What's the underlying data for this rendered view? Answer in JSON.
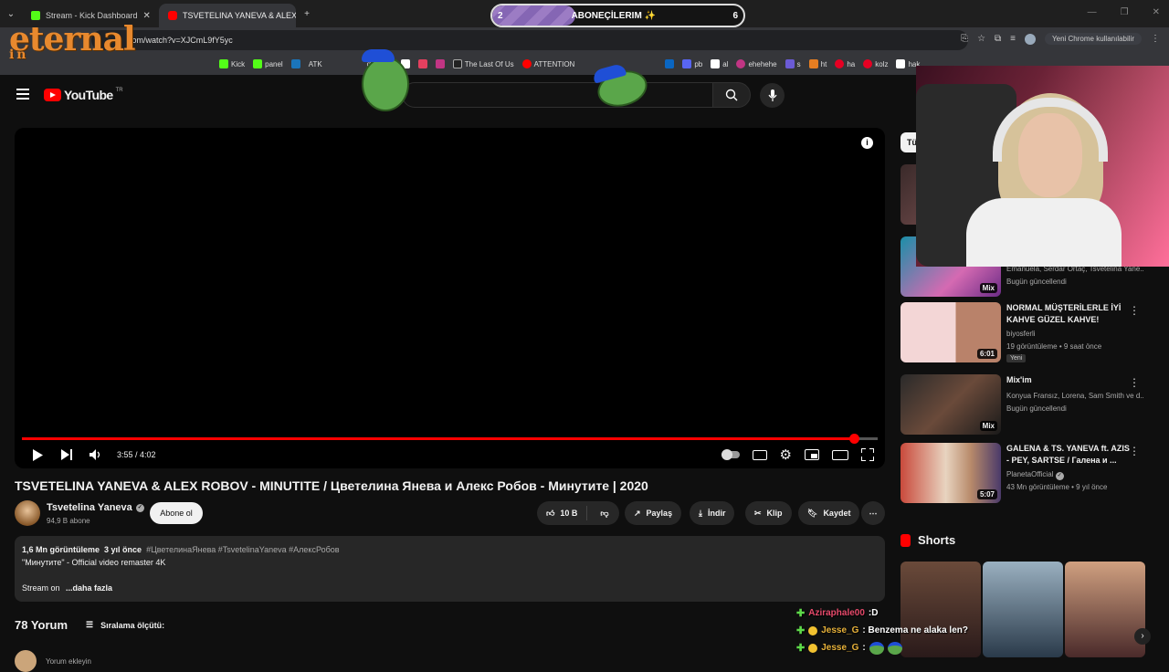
{
  "browser": {
    "tabs": [
      {
        "label": "Stream - Kick Dashboard",
        "color": "#53fc18"
      },
      {
        "label": "TSVETELINA YANEVA & ALEX R",
        "color": "#ff0000"
      }
    ],
    "url": "com/watch?v=XJCmL9fY5yc",
    "update_label": "Yeni Chrome kullanılabilir",
    "bookmarks": [
      "Kick",
      "panel",
      "ATK",
      "d+",
      "The Last Of Us",
      "ATTENTION",
      "pb",
      "ehehehe",
      "s",
      "ht",
      "ha",
      "kolz",
      "hak"
    ]
  },
  "overlay": {
    "logo_text": "eternal",
    "logo_sub": "i n",
    "sub_goal": {
      "current": "2",
      "label": "ABONEÇİLERIM ✨",
      "target": "6",
      "progress": 0.33
    }
  },
  "youtube": {
    "logo": "YouTube",
    "region": "TR",
    "player": {
      "time": "3:55 / 4:02",
      "progress": 0.972
    },
    "video_title": "TSVETELINA YANEVA & ALEX ROBOV - MINUTITE / Цветелина Янева и Алекс Робов - Минутите | 2020",
    "channel": {
      "name": "Tsvetelina Yaneva",
      "subs": "94,9 B abone"
    },
    "subscribe": "Abone ol",
    "actions": {
      "likes": "10 B",
      "share": "Paylaş",
      "download": "İndir",
      "clip": "Klip",
      "save": "Kaydet"
    },
    "description": {
      "views": "1,6 Mn görüntüleme",
      "age": "3 yıl önce",
      "tags": "#ЦветелинаЯнева #TsvetelinaYaneva #АлексРобов",
      "line1": "\"Минутите\" - Official video remaster 4K",
      "line2_prefix": "Stream on",
      "more": "...daha fazla"
    },
    "comments": {
      "count": "78 Yorum",
      "sort": "Sıralama ölçütü:",
      "add": "Yorum ekleyin"
    },
    "chip_all": "Tü",
    "recommendations": [
      {
        "title": "",
        "channel": "Emanuela, Serdar Ortaç, Tsvetelina Yane...",
        "meta": "Bugün güncellendi",
        "duration": "Mix",
        "badge": ""
      },
      {
        "title": "NORMAL MÜŞTERİLERLE İYİ KAHVE GÜZEL KAHVE!",
        "channel": "biyosferli",
        "meta": "19 görüntüleme • 9 saat önce",
        "duration": "6:01",
        "badge": "Yeni"
      },
      {
        "title": "Mix'im",
        "channel": "Konyua Fransız, Lorena, Sam Smith ve d...",
        "meta": "Bugün güncellendi",
        "duration": "Mix",
        "badge": ""
      },
      {
        "title": "GALENA & TS. YANEVA ft. AZIS - PEY, SARTSE / Галена и ...",
        "channel": "PlanetaOfficial",
        "meta": "43 Mn görüntüleme • 9 yıl önce",
        "duration": "5:07",
        "badge": ""
      }
    ],
    "shorts_title": "Shorts"
  },
  "chat": [
    {
      "user": "Aziraphale00",
      "text": ":D"
    },
    {
      "user": "Jesse_G",
      "text": ": Benzema ne alaka len?"
    },
    {
      "user": "Jesse_G",
      "text": ":"
    }
  ]
}
